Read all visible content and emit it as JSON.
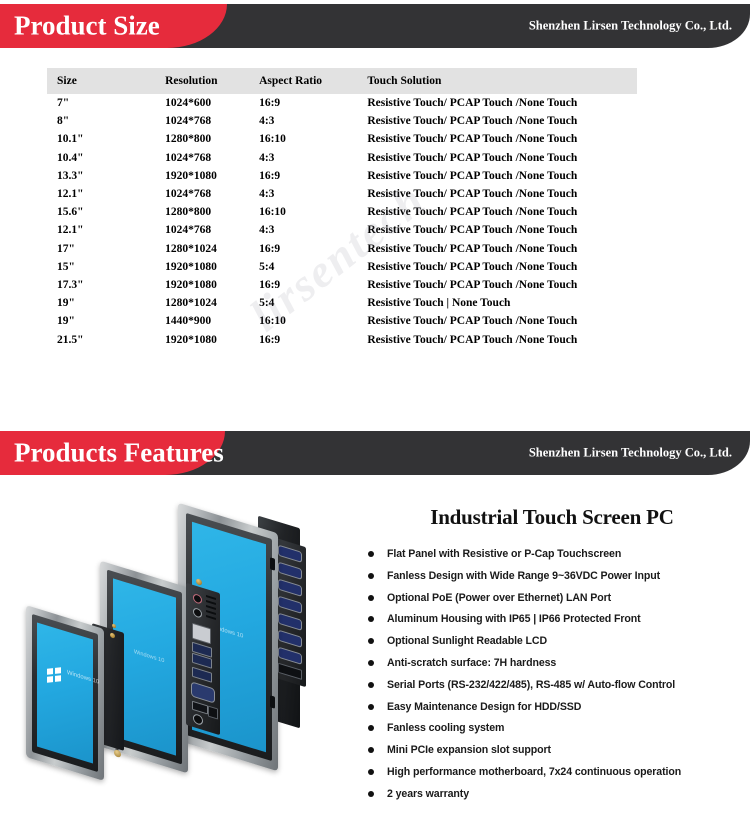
{
  "page": {
    "watermark_text": "lirsentech"
  },
  "sections": {
    "product_size": {
      "banner_title": "Product Size",
      "company": "Shenzhen Lirsen Technology Co., Ltd."
    },
    "products_features": {
      "banner_title": "Products Features",
      "company": "Shenzhen Lirsen Technology Co., Ltd."
    }
  },
  "spec_table": {
    "columns": [
      "Size",
      "Resolution",
      "Aspect Ratio",
      "Touch Solution"
    ],
    "rows": [
      {
        "size": "7\"",
        "resolution": "1024*600",
        "aspect": "16:9",
        "touch": "Resistive Touch/ PCAP Touch /None Touch"
      },
      {
        "size": "8\"",
        "resolution": "1024*768",
        "aspect": "4:3",
        "touch": "Resistive Touch/ PCAP Touch /None Touch"
      },
      {
        "size": "10.1\"",
        "resolution": "1280*800",
        "aspect": "16:10",
        "touch": "Resistive Touch/ PCAP Touch /None Touch"
      },
      {
        "size": "10.4\"",
        "resolution": "1024*768",
        "aspect": "4:3",
        "touch": "Resistive Touch/ PCAP Touch /None Touch"
      },
      {
        "size": "13.3\"",
        "resolution": "1920*1080",
        "aspect": "16:9",
        "touch": "Resistive Touch/ PCAP Touch /None Touch"
      },
      {
        "size": "12.1\"",
        "resolution": "1024*768",
        "aspect": "4:3",
        "touch": "Resistive Touch/ PCAP Touch /None Touch"
      },
      {
        "size": "15.6\"",
        "resolution": "1280*800",
        "aspect": "16:10",
        "touch": "Resistive Touch/ PCAP Touch /None Touch"
      },
      {
        "size": "12.1\"",
        "resolution": "1024*768",
        "aspect": "4:3",
        "touch": "Resistive Touch/ PCAP Touch /None Touch"
      },
      {
        "size": "17\"",
        "resolution": "1280*1024",
        "aspect": "16:9",
        "touch": "Resistive Touch/ PCAP Touch /None Touch"
      },
      {
        "size": "15\"",
        "resolution": "1920*1080",
        "aspect": "5:4",
        "touch": "Resistive Touch/ PCAP Touch /None Touch"
      },
      {
        "size": "17.3\"",
        "resolution": "1920*1080",
        "aspect": "16:9",
        "touch": "Resistive Touch/ PCAP Touch /None Touch"
      },
      {
        "size": "19\"",
        "resolution": "1280*1024",
        "aspect": "5:4",
        "touch": "Resistive Touch  | None Touch"
      },
      {
        "size": "19\"",
        "resolution": "1440*900",
        "aspect": "16:10",
        "touch": "Resistive Touch/ PCAP Touch /None Touch"
      },
      {
        "size": "21.5\"",
        "resolution": "1920*1080",
        "aspect": "16:9",
        "touch": "Resistive Touch/ PCAP Touch /None Touch"
      }
    ]
  },
  "features": {
    "title": "Industrial Touch Screen PC",
    "items": [
      "Flat Panel with Resistive or P-Cap Touchscreen",
      "Fanless Design with Wide Range 9~36VDC Power Input",
      "Optional PoE (Power over Ethernet) LAN Port",
      "Aluminum Housing with IP65  | IP66 Protected Front",
      "Optional Sunlight Readable LCD",
      "Anti-scratch surface: 7H hardness",
      "Serial Ports (RS-232/422/485), RS-485 w/ Auto-flow Control",
      "Easy Maintenance Design for HDD/SSD",
      "Fanless cooling system",
      "Mini PCIe expansion slot support",
      " High performance motherboard, 7x24 continuous operation",
      "2 years warranty"
    ]
  },
  "product_image": {
    "alt": "Three industrial touch panel PCs of different sizes shown at an angle with blue Windows screens and rear I/O ports",
    "screen_labels": [
      "Windows 10",
      "Windows 10",
      "Windows 10"
    ]
  },
  "colors": {
    "banner_red": "#e62b3c",
    "banner_dark": "#333335",
    "table_header_bg": "#e2e2e2",
    "screen_blue": "#23a8e0"
  }
}
